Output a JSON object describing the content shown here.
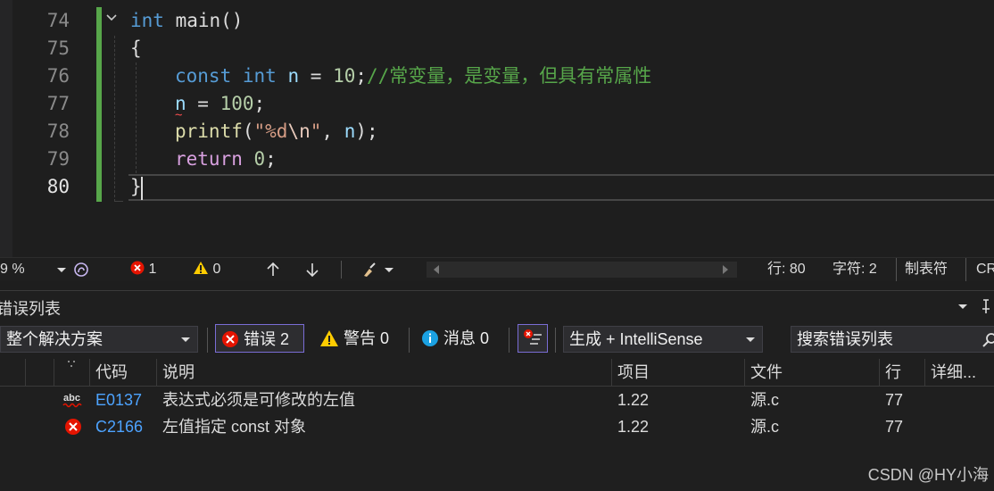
{
  "editor": {
    "line_numbers": [
      "74",
      "75",
      "76",
      "77",
      "78",
      "79",
      "80"
    ],
    "lines": {
      "l74": {
        "kw": "int",
        "rest": " main()"
      },
      "l75": {
        "text": "{"
      },
      "l76": {
        "kw1": "const",
        "kw2": "int",
        "var": "n",
        "op": " = ",
        "num": "10",
        "semi": ";",
        "comment": "//常变量，是变量，但具有常属性"
      },
      "l77": {
        "var": "n",
        "op": " = ",
        "num": "100",
        "semi": ";"
      },
      "l78": {
        "fn": "printf",
        "open": "(",
        "str1": "\"%d",
        "esc": "\\n",
        "str2": "\"",
        "comma": ", ",
        "var": "n",
        "close": ");"
      },
      "l79": {
        "kw": "return",
        "num": "0",
        "semi": ";"
      },
      "l80": {
        "text": "}"
      }
    }
  },
  "statusbar": {
    "zoom": "9 %",
    "errors": "1",
    "warnings": "0",
    "line_label": "行: 80",
    "char_label": "字符: 2",
    "indent_label": "制表符",
    "eol_label": "CR"
  },
  "error_list": {
    "title": "错误列表",
    "scope": "整个解决方案",
    "errors_btn": "错误 2",
    "warnings_btn": "警告 0",
    "messages_btn": "消息 0",
    "build_filter": "生成 + IntelliSense",
    "search_placeholder": "搜索错误列表",
    "headers": {
      "code": "代码",
      "desc": "说明",
      "project": "项目",
      "file": "文件",
      "line": "行",
      "detail": "详细..."
    },
    "rows": [
      {
        "icon": "spelling-error-icon",
        "code": "E0137",
        "desc": "表达式必须是可修改的左值",
        "project": "1.22",
        "file": "源.c",
        "line": "77"
      },
      {
        "icon": "error-icon",
        "code": "C2166",
        "desc": "左值指定 const 对象",
        "project": "1.22",
        "file": "源.c",
        "line": "77"
      }
    ]
  },
  "watermark": "CSDN @HY小海",
  "colors": {
    "accent": "#7a6dd6",
    "error": "#e51400",
    "warning": "#ffcc00",
    "info": "#1ba1e2",
    "change_bar": "#57a64a"
  }
}
